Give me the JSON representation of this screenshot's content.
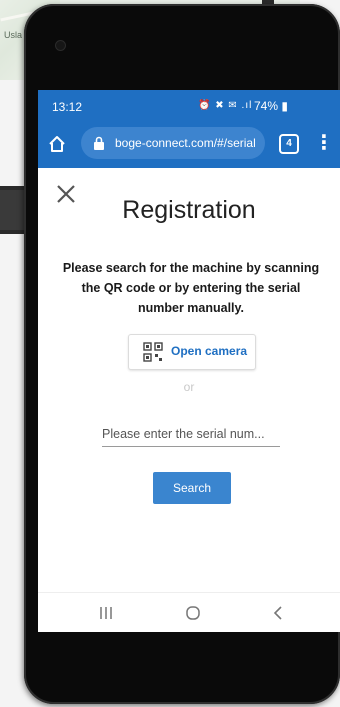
{
  "background": {
    "map_label": "Usla"
  },
  "status_bar": {
    "time": "13:12",
    "icons": "⏰ ✖ ✉ .ıl",
    "battery": "74% ▮"
  },
  "browser": {
    "url": "boge-connect.com/#/serial",
    "tab_count": "4",
    "menu": "⋮"
  },
  "page": {
    "title": "Registration",
    "instruction": "Please search for the machine by scanning the QR code or by entering the serial number manually.",
    "open_camera_label": "Open camera",
    "or_text": "or",
    "serial_placeholder": "Please enter the serial num...",
    "search_label": "Search"
  },
  "colors": {
    "accent": "#1f6fc2",
    "button": "#3a85cf"
  },
  "icons": [
    "home-icon",
    "lock-icon",
    "tabs-icon",
    "menu-icon",
    "close-icon",
    "qr-code-icon",
    "recent-apps-icon",
    "home-nav-icon",
    "back-icon"
  ]
}
